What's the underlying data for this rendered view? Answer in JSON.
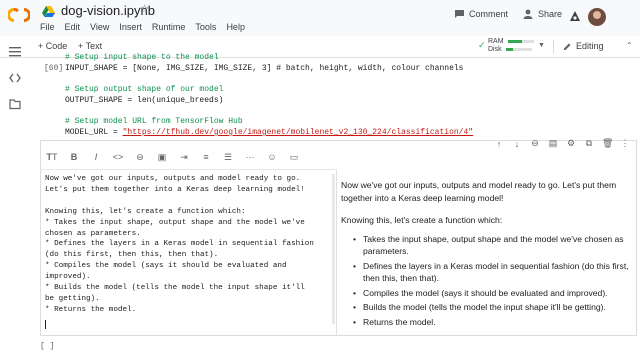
{
  "header": {
    "title": "dog-vision.ipynb",
    "menu": [
      "File",
      "Edit",
      "View",
      "Insert",
      "Runtime",
      "Tools",
      "Help"
    ],
    "comment_label": "Comment",
    "share_label": "Share"
  },
  "toolbar": {
    "add_code_label": "+ Code",
    "add_text_label": "+ Text",
    "ram_label": "RAM",
    "disk_label": "Disk",
    "ram_usage": 0.55,
    "disk_usage": 0.3,
    "editing_label": "Editing"
  },
  "code_cell": {
    "prompt": "[60]",
    "lines": [
      "# Setup input shape to the model",
      "INPUT_SHAPE = [None, IMG_SIZE, IMG_SIZE, 3] # batch, height, width, colour channels",
      "",
      "# Setup output shape of our model",
      "OUTPUT_SHAPE = len(unique_breeds)",
      "",
      "# Setup model URL from TensorFlow Hub",
      "MODEL_URL = \"https://tfhub.dev/google/imagenet/mobilenet_v2_130_224/classification/4\""
    ]
  },
  "text_cell": {
    "toolbar_icons": [
      "bold-icon",
      "italic-icon",
      "code-icon",
      "link-icon",
      "image-icon",
      "indent-icon",
      "numbered-list-icon",
      "bulleted-list-icon",
      "horizontal-rule-icon",
      "emoji-icon"
    ],
    "cell_actions": [
      "move-up-icon",
      "move-down-icon",
      "link-icon",
      "comment-icon",
      "settings-icon",
      "mirror-icon",
      "delete-icon",
      "more-icon"
    ],
    "source": "Now we've got our inputs, outputs and model ready to go.\nLet's put them together into a Keras deep learning model!\n\nKnowing this, let's create a function which:\n* Takes the input shape, output shape and the model we've\nchosen as parameters.\n* Defines the layers in a Keras model in sequential fashion\n(do this first, then this, then that).\n* Compiles the model (says it should be evaluated and\nimproved).\n* Builds the model (tells the model the input shape it'll\nbe getting).\n* Returns the model.",
    "preview": {
      "intro": "Now we've got our inputs, outputs and model ready to go. Let's put them together into a Keras deep learning model!",
      "lead": "Knowing this, let's create a function which:",
      "items": [
        "Takes the input shape, output shape and the model we've chosen as parameters.",
        "Defines the layers in a Keras model in sequential fashion (do this first, then this, then that).",
        "Compiles the model (says it should be evaluated and improved).",
        "Builds the model (tells the model the input shape it'll be getting).",
        "Returns the model."
      ]
    }
  },
  "empty_cell": {
    "prompt": "[ ]"
  },
  "colors": {
    "comment_green": "#0d904f",
    "string_red": "#c41a16",
    "logo_orange": "#f9ab00"
  }
}
